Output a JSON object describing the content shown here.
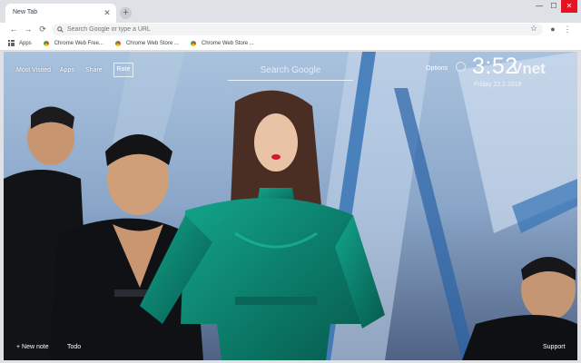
{
  "tab": {
    "title": "New Tab",
    "close_glyph": "✕"
  },
  "newtab_glyph": "+",
  "window_controls": {
    "minimize": "—",
    "maximize": "☐",
    "close": "✕"
  },
  "toolbar": {
    "back_glyph": "←",
    "forward_glyph": "→",
    "reload_glyph": "⟳",
    "omnibox_placeholder": "Search Google or type a URL",
    "star_glyph": "☆",
    "account_glyph": "●",
    "menu_glyph": "⋮"
  },
  "bookmarks": [
    {
      "label": "Apps",
      "icon": "apps-grid-icon"
    },
    {
      "label": "Chrome Web Free...",
      "icon": "chrome-icon"
    },
    {
      "label": "Chrome Web Store ...",
      "icon": "chrome-icon"
    },
    {
      "label": "Chrome Web Store ...",
      "icon": "chrome-icon"
    }
  ],
  "ntp": {
    "links": {
      "most_visited": "Most Visited",
      "apps": "Apps",
      "share": "Share",
      "rate": "Rate"
    },
    "search_placeholder": "Search Google",
    "options": "Options",
    "clock": "3:52",
    "date": "Friday   22.2.2019",
    "watermark": "Vnet",
    "bottom": {
      "new_note": "+ New note",
      "todo": "Todo",
      "support": "Support"
    }
  },
  "colors": {
    "tabstrip": "#dee1e6",
    "toolbar": "#ffffff",
    "close_red": "#e81123",
    "dress_green": "#0f8f7a"
  }
}
